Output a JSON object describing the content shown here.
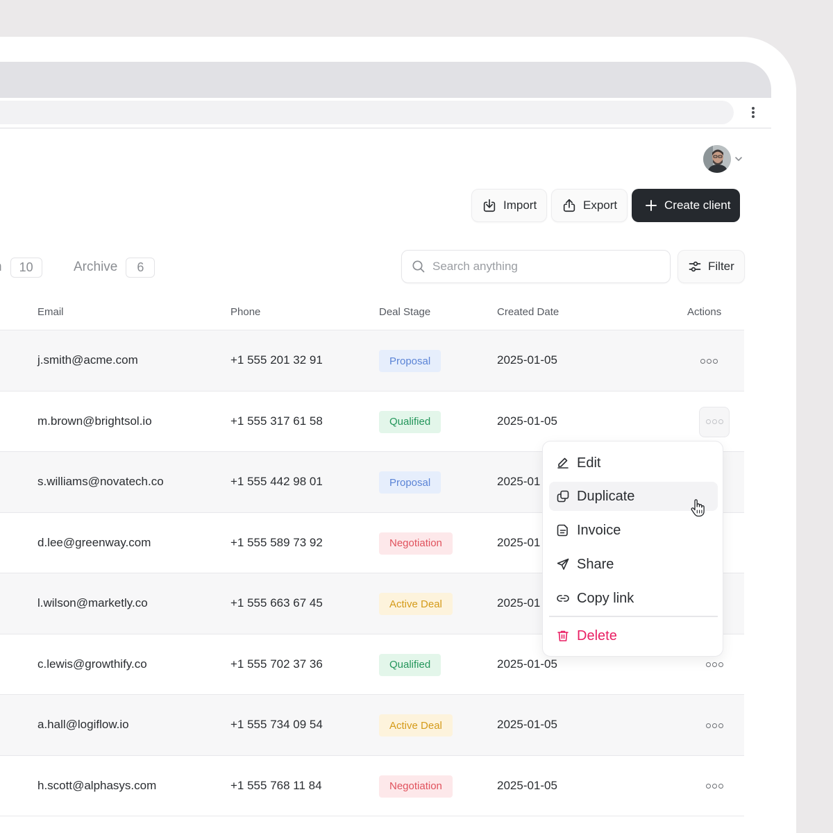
{
  "header": {
    "import_label": "Import",
    "export_label": "Export",
    "create_label": "Create client"
  },
  "tabs": [
    {
      "label": "n",
      "count": "10"
    },
    {
      "label": "Archive",
      "count": "6"
    }
  ],
  "search": {
    "placeholder": "Search anything"
  },
  "filter_label": "Filter",
  "table": {
    "columns": [
      "Email",
      "Phone",
      "Deal Stage",
      "Created Date",
      "Actions"
    ],
    "rows": [
      {
        "email": "j.smith@acme.com",
        "phone": "+1 555 201 32 91",
        "stage": "Proposal",
        "date": "2025-01-05"
      },
      {
        "email": "m.brown@brightsol.io",
        "phone": "+1 555 317 61 58",
        "stage": "Qualified",
        "date": "2025-01-05"
      },
      {
        "email": "s.williams@novatech.co",
        "phone": "+1 555 442 98 01",
        "stage": "Proposal",
        "date": "2025-01"
      },
      {
        "email": "d.lee@greenway.com",
        "phone": "+1 555 589 73 92",
        "stage": "Negotiation",
        "date": "2025-01"
      },
      {
        "email": "l.wilson@marketly.co",
        "phone": "+1 555 663 67 45",
        "stage": "Active Deal",
        "date": "2025-01"
      },
      {
        "email": "c.lewis@growthify.co",
        "phone": "+1 555 702 37 36",
        "stage": "Qualified",
        "date": "2025-01-05"
      },
      {
        "email": "a.hall@logiflow.io",
        "phone": "+1 555 734 09 54",
        "stage": "Active Deal",
        "date": "2025-01-05"
      },
      {
        "email": "h.scott@alphasys.com",
        "phone": "+1 555 768 11 84",
        "stage": "Negotiation",
        "date": "2025-01-05"
      }
    ]
  },
  "stage_colors": {
    "Proposal": {
      "bg": "#e6eefc",
      "fg": "#5b84d6"
    },
    "Qualified": {
      "bg": "#e3f6ea",
      "fg": "#23955a"
    },
    "Negotiation": {
      "bg": "#fde8ea",
      "fg": "#e0525d"
    },
    "Active Deal": {
      "bg": "#fdf3dc",
      "fg": "#d49a18"
    }
  },
  "context_menu": {
    "items": [
      {
        "label": "Edit",
        "icon": "pencil-icon"
      },
      {
        "label": "Duplicate",
        "icon": "duplicate-icon"
      },
      {
        "label": "Invoice",
        "icon": "invoice-icon"
      },
      {
        "label": "Share",
        "icon": "send-icon"
      },
      {
        "label": "Copy link",
        "icon": "link-icon"
      }
    ],
    "delete_label": "Delete",
    "danger_color": "#e91e63"
  }
}
